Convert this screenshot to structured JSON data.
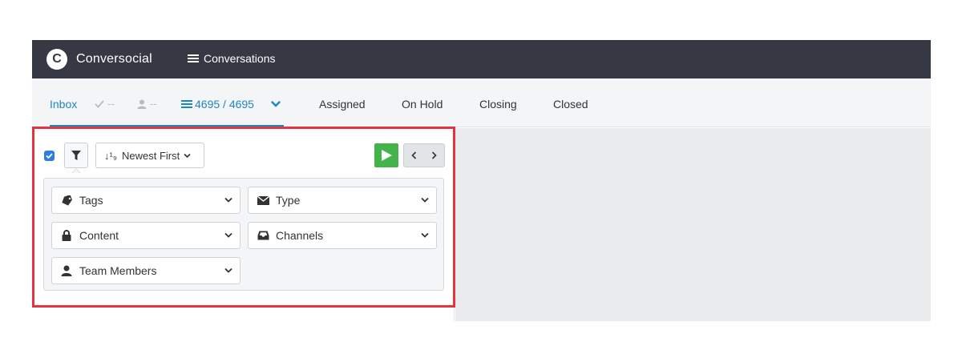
{
  "brand": {
    "logo_letter": "C",
    "name": "Conversocial"
  },
  "topnav": {
    "conversations_label": "Conversations"
  },
  "tabs": {
    "inbox_label": "Inbox",
    "checked_count": "--",
    "person_count": "--",
    "count_label": "4695 / 4695",
    "items": [
      "Assigned",
      "On Hold",
      "Closing",
      "Closed"
    ]
  },
  "toolbar": {
    "select_all_checked": true,
    "sort_icon_text": "↓¹₉",
    "sort_label": "Newest First"
  },
  "filters": {
    "tags": "Tags",
    "type": "Type",
    "content": "Content",
    "channels": "Channels",
    "team_members": "Team Members"
  },
  "colors": {
    "topbar": "#363844",
    "accent": "#1f86c1",
    "play": "#44b34a",
    "highlight": "#e2363c",
    "right_panel": "#e9ebec"
  }
}
